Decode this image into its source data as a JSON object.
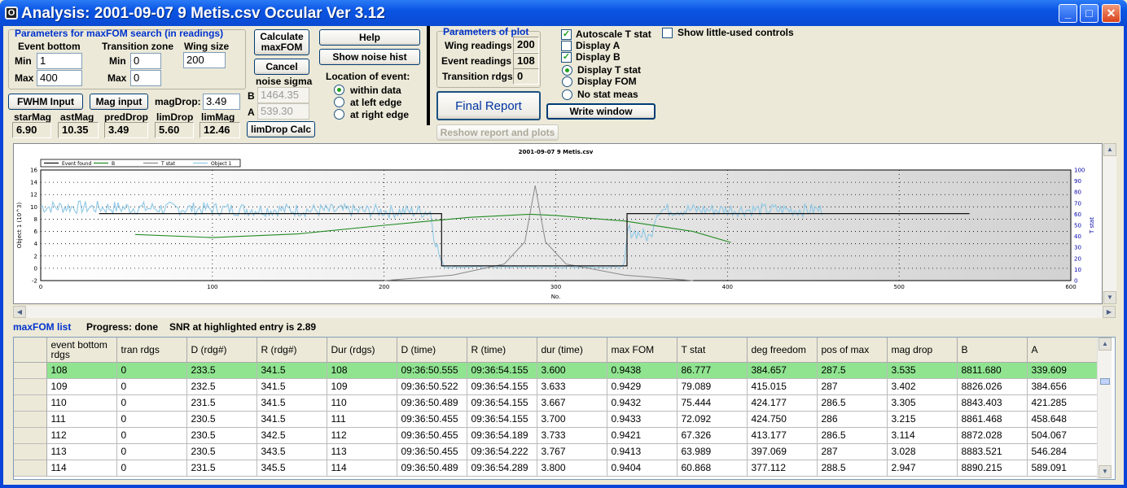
{
  "window": {
    "title": "Analysis: 2001-09-07 9 Metis.csv  Occular Ver 3.12"
  },
  "search": {
    "group_title": "Parameters for maxFOM search (in readings)",
    "event_bottom_label": "Event bottom",
    "min_label": "Min",
    "min_value": "1",
    "max_label": "Max",
    "max_value": "400",
    "transition_label": "Transition zone",
    "tmin_label": "Min",
    "tmin_value": "0",
    "tmax_label": "Max",
    "tmax_value": "0",
    "wing_size_label": "Wing size",
    "wing_size_value": "200"
  },
  "buttons": {
    "calculate": "Calculate maxFOM",
    "cancel": "Cancel",
    "help": "Help",
    "show_noise_hist": "Show noise hist",
    "fwhm_input": "FWHM Input",
    "mag_input": "Mag input",
    "limdrop_calc": "limDrop Calc",
    "final_report": "Final Report",
    "write_window": "Write window",
    "reshow": "Reshow report and plots"
  },
  "magdrop": {
    "label": "magDrop:",
    "value": "3.49"
  },
  "noise": {
    "label": "noise sigma",
    "b_label": "B",
    "b_value": "1464.35",
    "a_label": "A",
    "a_value": "539.30"
  },
  "location": {
    "label": "Location of event:",
    "options": [
      "within data",
      "at left edge",
      "at right edge"
    ],
    "selected": 0
  },
  "stats": [
    {
      "label": "starMag",
      "value": "6.90"
    },
    {
      "label": "astMag",
      "value": "10.35"
    },
    {
      "label": "predDrop",
      "value": "3.49"
    },
    {
      "label": "limDrop",
      "value": "5.60"
    },
    {
      "label": "limMag",
      "value": "12.46"
    }
  ],
  "plot_params": {
    "title": "Parameters of plot",
    "wing_label": "Wing readings",
    "wing_value": "200",
    "event_label": "Event readings",
    "event_value": "108",
    "trans_label": "Transition rdgs",
    "trans_value": "0"
  },
  "display": {
    "autoscale": "Autoscale T stat",
    "autoscale_checked": true,
    "display_a": "Display A",
    "display_a_checked": false,
    "display_b": "Display B",
    "display_b_checked": true,
    "radio_tstat": "Display T stat",
    "radio_fom": "Display FOM",
    "radio_nostat": "No stat meas",
    "radio_selected": 0,
    "little_used": "Show little-used controls",
    "little_used_checked": false
  },
  "chart_data": {
    "type": "line",
    "title": "2001-09-07 9 Metis.csv",
    "xlabel": "No.",
    "ylabel": "Object 1 (10^3)",
    "y2label": "T stat",
    "xlim": [
      0,
      600
    ],
    "ylim": [
      -2,
      16
    ],
    "y2lim": [
      0,
      100
    ],
    "xticks": [
      "0",
      "100",
      "200",
      "300",
      "400",
      "500",
      "600"
    ],
    "yticks": [
      "-2",
      "0",
      "2",
      "4",
      "6",
      "8",
      "10",
      "12",
      "14",
      "16"
    ],
    "y2ticks": [
      "0",
      "10",
      "20",
      "30",
      "40",
      "50",
      "60",
      "70",
      "80",
      "90",
      "100"
    ],
    "legend": [
      "Event found",
      "B",
      "T stat",
      "Object 1"
    ],
    "colors": {
      "event": "#111111",
      "b": "#228b22",
      "tstat": "#888888",
      "object": "#8fc9e6"
    },
    "series": [
      {
        "name": "Event found",
        "x": [
          34,
          233.5,
          233.5,
          341.5,
          341.5,
          541
        ],
        "y": [
          8.9,
          8.9,
          0.4,
          0.4,
          8.9,
          8.9
        ]
      },
      {
        "name": "B",
        "x": [
          55,
          100,
          150,
          200,
          250,
          285,
          300,
          340,
          380,
          402
        ],
        "y": [
          5.5,
          5.0,
          5.6,
          7.0,
          8.3,
          8.8,
          8.6,
          7.7,
          6.0,
          4.2
        ]
      },
      {
        "name": "T stat",
        "x": [
          200,
          240,
          270,
          282,
          288,
          294,
          306,
          340,
          380
        ],
        "y": [
          0,
          5,
          15,
          35,
          86,
          35,
          15,
          5,
          0
        ]
      },
      {
        "name": "Object 1",
        "x": [
          0,
          227,
          229,
          234,
          340,
          342,
          355,
          358,
          360,
          455
        ],
        "y": [
          10.0,
          9.2,
          5.5,
          0.2,
          0.2,
          6.2,
          5.0,
          8.5,
          9.5,
          9.5
        ]
      }
    ]
  },
  "list": {
    "title": "maxFOM list",
    "progress": "Progress: done",
    "snr": "SNR at highlighted entry is 2.89",
    "columns": [
      "event bottom rdgs",
      "tran rdgs",
      "D (rdg#)",
      "R (rdg#)",
      "Dur (rdgs)",
      "D (time)",
      "R (time)",
      "dur (time)",
      "max FOM",
      "T stat",
      "deg freedom",
      "pos of max",
      "mag drop",
      "B",
      "A"
    ],
    "rows": [
      [
        "108",
        "0",
        "233.5",
        "341.5",
        "108",
        "09:36:50.555",
        "09:36:54.155",
        "3.600",
        "0.9438",
        "86.777",
        "384.657",
        "287.5",
        "3.535",
        "8811.680",
        "339.609"
      ],
      [
        "109",
        "0",
        "232.5",
        "341.5",
        "109",
        "09:36:50.522",
        "09:36:54.155",
        "3.633",
        "0.9429",
        "79.089",
        "415.015",
        "287",
        "3.402",
        "8826.026",
        "384.656"
      ],
      [
        "110",
        "0",
        "231.5",
        "341.5",
        "110",
        "09:36:50.489",
        "09:36:54.155",
        "3.667",
        "0.9432",
        "75.444",
        "424.177",
        "286.5",
        "3.305",
        "8843.403",
        "421.285"
      ],
      [
        "111",
        "0",
        "230.5",
        "341.5",
        "111",
        "09:36:50.455",
        "09:36:54.155",
        "3.700",
        "0.9433",
        "72.092",
        "424.750",
        "286",
        "3.215",
        "8861.468",
        "458.648"
      ],
      [
        "112",
        "0",
        "230.5",
        "342.5",
        "112",
        "09:36:50.455",
        "09:36:54.189",
        "3.733",
        "0.9421",
        "67.326",
        "413.177",
        "286.5",
        "3.114",
        "8872.028",
        "504.067"
      ],
      [
        "113",
        "0",
        "230.5",
        "343.5",
        "113",
        "09:36:50.455",
        "09:36:54.222",
        "3.767",
        "0.9413",
        "63.989",
        "397.069",
        "287",
        "3.028",
        "8883.521",
        "546.284"
      ],
      [
        "114",
        "0",
        "231.5",
        "345.5",
        "114",
        "09:36:50.489",
        "09:36:54.289",
        "3.800",
        "0.9404",
        "60.868",
        "377.112",
        "288.5",
        "2.947",
        "8890.215",
        "589.091"
      ]
    ]
  }
}
